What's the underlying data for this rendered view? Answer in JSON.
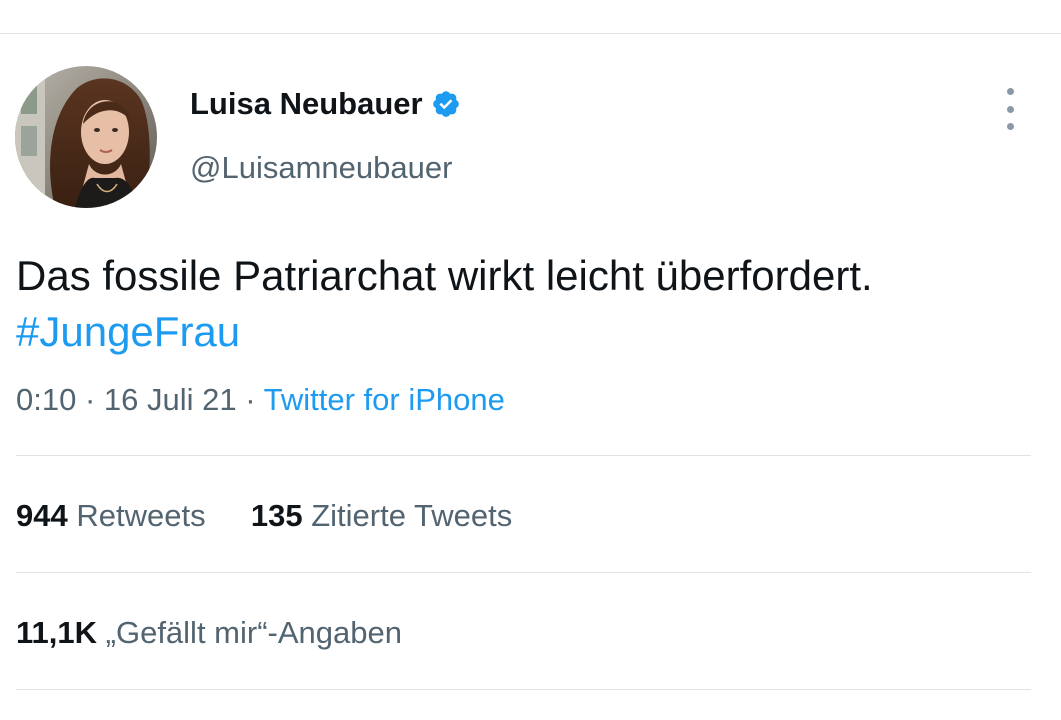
{
  "user": {
    "display_name": "Luisa Neubauer",
    "handle": "@Luisamneubauer",
    "verified": true,
    "verified_icon": "verified-badge-icon",
    "verified_color": "#1d9bf0"
  },
  "tweet": {
    "text": "Das fossile Patriarchat wirkt leicht überfordert.",
    "hashtag": "#JungeFrau",
    "time": "0:10",
    "date": "16 Juli 21",
    "separator": "·",
    "source": "Twitter for iPhone"
  },
  "stats": {
    "retweets_count": "944",
    "retweets_label": "Retweets",
    "quotes_count": "135",
    "quotes_label": "Zitierte Tweets",
    "likes_count": "11,1K",
    "likes_label": "„Gefällt mir“-Angaben"
  },
  "colors": {
    "link": "#1d9bf0",
    "secondary_text": "#536471",
    "primary_text": "#0f1419"
  },
  "icons": {
    "more": "more-vertical-icon"
  }
}
